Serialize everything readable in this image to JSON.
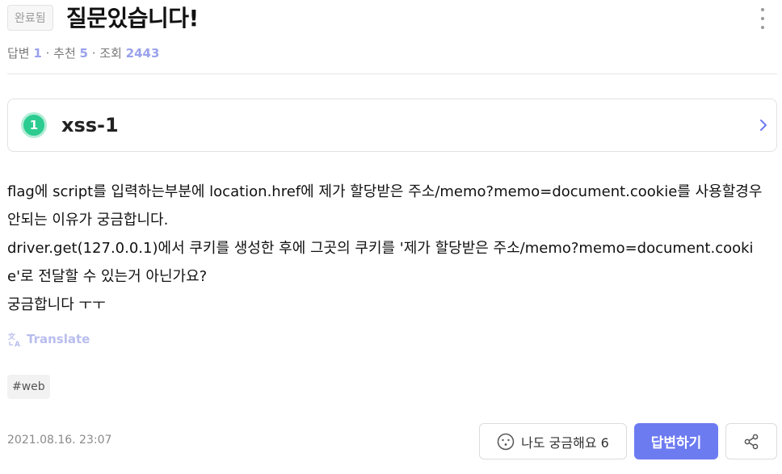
{
  "header": {
    "status_badge": "완료됨",
    "title": "질문있습니다!",
    "more_icon": "more-vertical-icon"
  },
  "stats": {
    "answers_label": "답변",
    "answers_count": "1",
    "recommend_label": "추천",
    "recommend_count": "5",
    "views_label": "조회",
    "views_count": "2443",
    "separator": " · "
  },
  "challenge": {
    "level": "1",
    "name": "xss-1",
    "level_color": "#2ccc91",
    "chevron_icon": "chevron-right-icon"
  },
  "body": {
    "text": "flag에 script를 입력하는부분에 location.href에 제가 할당받은 주소/memo?memo=document.cookie를 사용할경우 안되는 이유가 궁금합니다.\ndriver.get(127.0.0.1)에서 쿠키를 생성한 후에 그곳의 쿠키를 '제가 할당받은 주소/memo?memo=document.cookie'로 전달할 수 있는거 아닌가요?\n궁금합니다 ㅜㅜ"
  },
  "translate": {
    "label": "Translate",
    "icon": "translate-icon"
  },
  "tags": [
    "#web"
  ],
  "footer": {
    "date": "2021.08.16. 23:07",
    "curious_label": "나도 궁금해요",
    "curious_count": "6",
    "answer_label": "답변하기",
    "accent_color": "#6d7bf1",
    "share_icon": "share-icon"
  }
}
